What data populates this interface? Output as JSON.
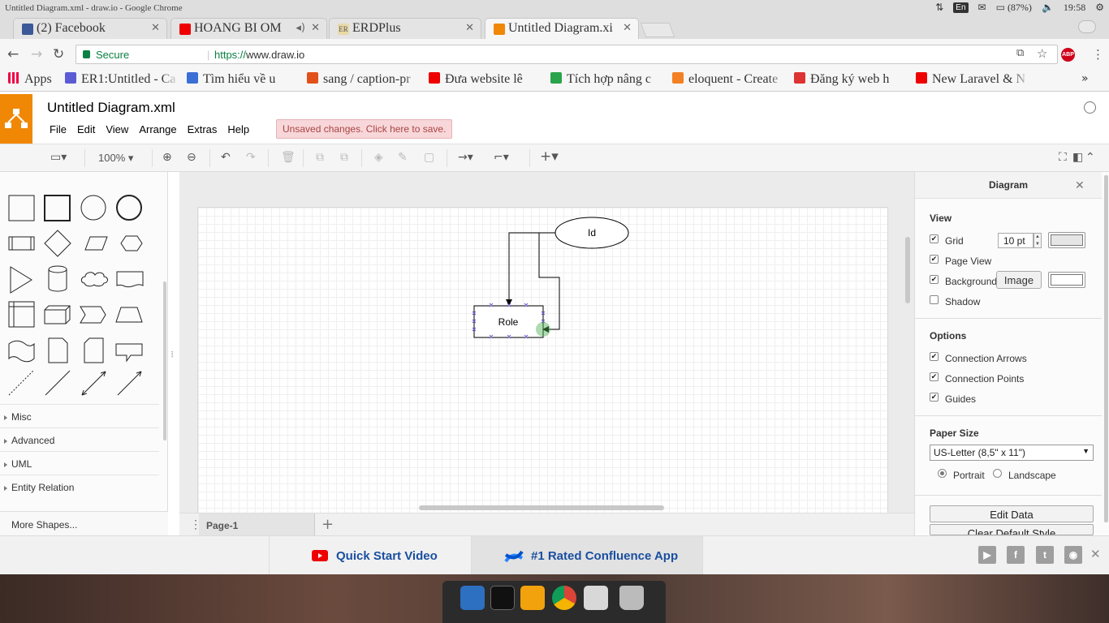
{
  "os": {
    "window_title": "Untitled Diagram.xml - draw.io - Google Chrome",
    "lang": "En",
    "battery": "(87%)",
    "time": "19:58"
  },
  "tabs": [
    {
      "label": "(2) Facebook",
      "fav_color": "#3b5998"
    },
    {
      "label": "HOANG BI OM",
      "fav_color": "#e00"
    },
    {
      "label": "ERDPlus",
      "fav_color": "#e8d9a8"
    },
    {
      "label": "Untitled Diagram.xi",
      "fav_color": "#f08705"
    }
  ],
  "address": {
    "secure_label": "Secure",
    "url_scheme": "https://",
    "url_host": "www.draw.io"
  },
  "bookmarks": [
    {
      "label": "Apps",
      "color": "#e04"
    },
    {
      "label": "ER1:Untitled - Ca",
      "color": "#5b5bd6"
    },
    {
      "label": "Tìm hiểu về u",
      "color": "#3b6fd6"
    },
    {
      "label": "sang / caption-pr",
      "color": "#e2501a"
    },
    {
      "label": "Đưa website lê",
      "color": "#e00"
    },
    {
      "label": "Tích hợp nâng c",
      "color": "#2aa34a"
    },
    {
      "label": "eloquent - Create",
      "color": "#f48024"
    },
    {
      "label": "Đăng ký web h",
      "color": "#d33"
    },
    {
      "label": "New Laravel & N",
      "color": "#e00"
    }
  ],
  "app": {
    "title": "Untitled Diagram.xml",
    "menu": [
      "File",
      "Edit",
      "View",
      "Arrange",
      "Extras",
      "Help"
    ],
    "unsaved_notice": "Unsaved changes. Click here to save.",
    "zoom": "100%"
  },
  "sidebar": {
    "categories": [
      "Misc",
      "Advanced",
      "UML",
      "Entity Relation"
    ],
    "more_shapes": "More Shapes..."
  },
  "diagram": {
    "ellipse_label": "Id",
    "rect_label": "Role"
  },
  "page_tabs": {
    "current": "Page-1"
  },
  "format_panel": {
    "title": "Diagram",
    "view_heading": "View",
    "grid_label": "Grid",
    "grid_size": "10 pt",
    "page_view_label": "Page View",
    "background_label": "Background",
    "image_button": "Image",
    "shadow_label": "Shadow",
    "options_heading": "Options",
    "conn_arrows_label": "Connection Arrows",
    "conn_points_label": "Connection Points",
    "guides_label": "Guides",
    "paper_heading": "Paper Size",
    "paper_value": "US-Letter (8,5\" x 11\")",
    "portrait_label": "Portrait",
    "landscape_label": "Landscape",
    "edit_data": "Edit Data",
    "clear_style": "Clear Default Style"
  },
  "footer": {
    "quick_start": "Quick Start Video",
    "confluence": "#1 Rated Confluence App"
  }
}
